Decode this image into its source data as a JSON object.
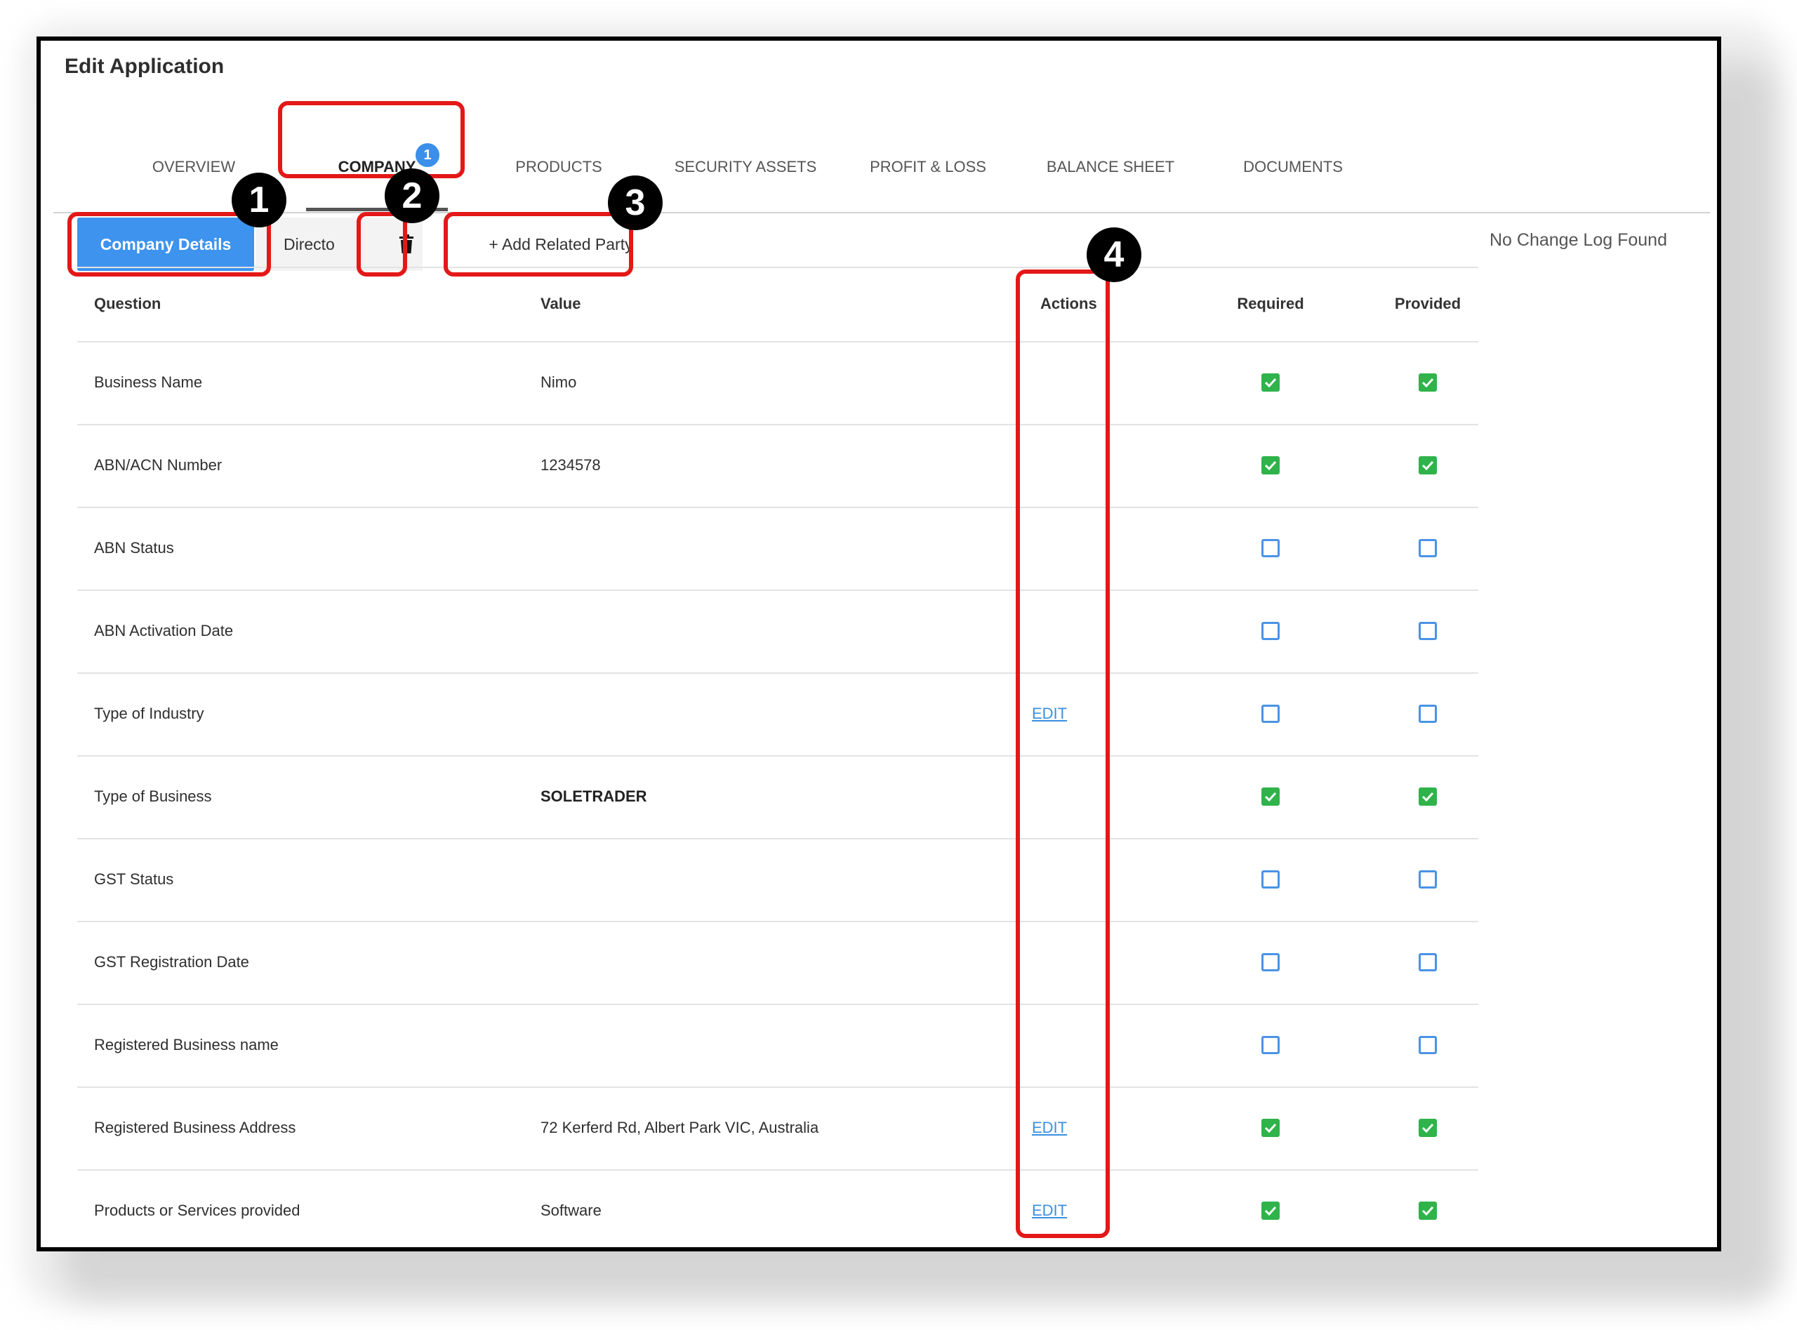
{
  "window": {
    "title": "Edit Application"
  },
  "tabs": [
    {
      "label": "OVERVIEW"
    },
    {
      "label": "COMPANY",
      "badge": "1",
      "active": true
    },
    {
      "label": "PRODUCTS"
    },
    {
      "label": "SECURITY ASSETS"
    },
    {
      "label": "PROFIT & LOSS"
    },
    {
      "label": "BALANCE SHEET"
    },
    {
      "label": "DOCUMENTS"
    }
  ],
  "subtabs": {
    "company_details": "Company Details",
    "director": "Directo",
    "add_related_party": "+ Add Related Party"
  },
  "change_log": "No Change Log Found",
  "table": {
    "headers": {
      "question": "Question",
      "value": "Value",
      "actions": "Actions",
      "required": "Required",
      "provided": "Provided"
    },
    "rows": [
      {
        "question": "Business Name",
        "value": "Nimo",
        "action": "",
        "required": true,
        "provided": true
      },
      {
        "question": "ABN/ACN Number",
        "value": "1234578",
        "action": "",
        "required": true,
        "provided": true
      },
      {
        "question": "ABN Status",
        "value": "",
        "action": "",
        "required": false,
        "provided": false
      },
      {
        "question": "ABN Activation Date",
        "value": "",
        "action": "",
        "required": false,
        "provided": false
      },
      {
        "question": "Type of Industry",
        "value": "",
        "action": "EDIT",
        "required": false,
        "provided": false
      },
      {
        "question": "Type of Business",
        "value": "SOLETRADER",
        "action": "",
        "required": true,
        "provided": true
      },
      {
        "question": "GST Status",
        "value": "",
        "action": "",
        "required": false,
        "provided": false
      },
      {
        "question": "GST Registration Date",
        "value": "",
        "action": "",
        "required": false,
        "provided": false
      },
      {
        "question": "Registered Business name",
        "value": "",
        "action": "",
        "required": false,
        "provided": false
      },
      {
        "question": "Registered Business Address",
        "value": "72 Kerferd Rd, Albert Park VIC, Australia",
        "action": "EDIT",
        "required": true,
        "provided": true
      },
      {
        "question": "Products or Services provided",
        "value": "Software",
        "action": "EDIT",
        "required": true,
        "provided": true
      }
    ]
  },
  "annotations": [
    "1",
    "2",
    "3",
    "4"
  ],
  "colors": {
    "primary": "#3d93ed",
    "check_green": "#2fb34a",
    "annotation_red": "#e41818",
    "badge_blue": "#3b8fe8"
  },
  "icons": {
    "delete": "trash-icon",
    "checked": "checkbox-checked-icon",
    "unchecked": "checkbox-unchecked-icon"
  }
}
